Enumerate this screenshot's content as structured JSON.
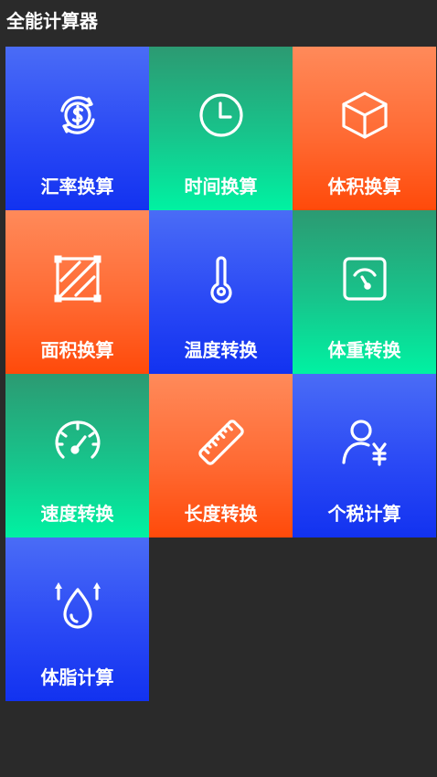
{
  "app": {
    "title": "全能计算器"
  },
  "colors": {
    "background": "#2a2a2a",
    "blue": "#2a49f5",
    "green": "#17c58c",
    "orange": "#ff6a33",
    "text": "#ffffff"
  },
  "tiles": [
    {
      "label": "汇率换算",
      "icon": "currency-exchange-icon",
      "color": "blue"
    },
    {
      "label": "时间换算",
      "icon": "clock-icon",
      "color": "green"
    },
    {
      "label": "体积换算",
      "icon": "cube-icon",
      "color": "orange"
    },
    {
      "label": "面积换算",
      "icon": "area-square-icon",
      "color": "orange"
    },
    {
      "label": "温度转换",
      "icon": "thermometer-icon",
      "color": "blue"
    },
    {
      "label": "体重转换",
      "icon": "scale-icon",
      "color": "green"
    },
    {
      "label": "速度转换",
      "icon": "speedometer-icon",
      "color": "green"
    },
    {
      "label": "长度转换",
      "icon": "ruler-icon",
      "color": "orange"
    },
    {
      "label": "个税计算",
      "icon": "person-yen-icon",
      "color": "blue"
    },
    {
      "label": "体脂计算",
      "icon": "water-drop-icon",
      "color": "blue"
    }
  ]
}
